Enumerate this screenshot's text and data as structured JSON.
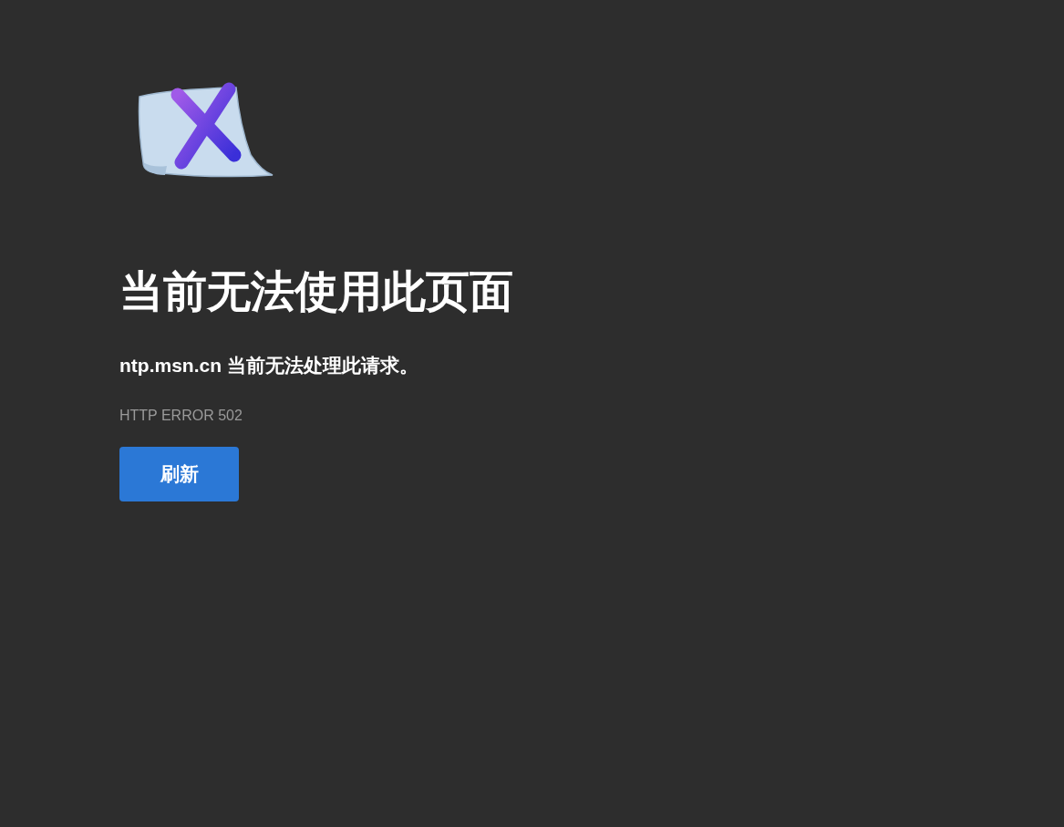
{
  "title": "当前无法使用此页面",
  "message": "ntp.msn.cn 当前无法处理此请求。",
  "error_code": "HTTP ERROR 502",
  "buttons": [
    {
      "label": "刷新"
    }
  ]
}
